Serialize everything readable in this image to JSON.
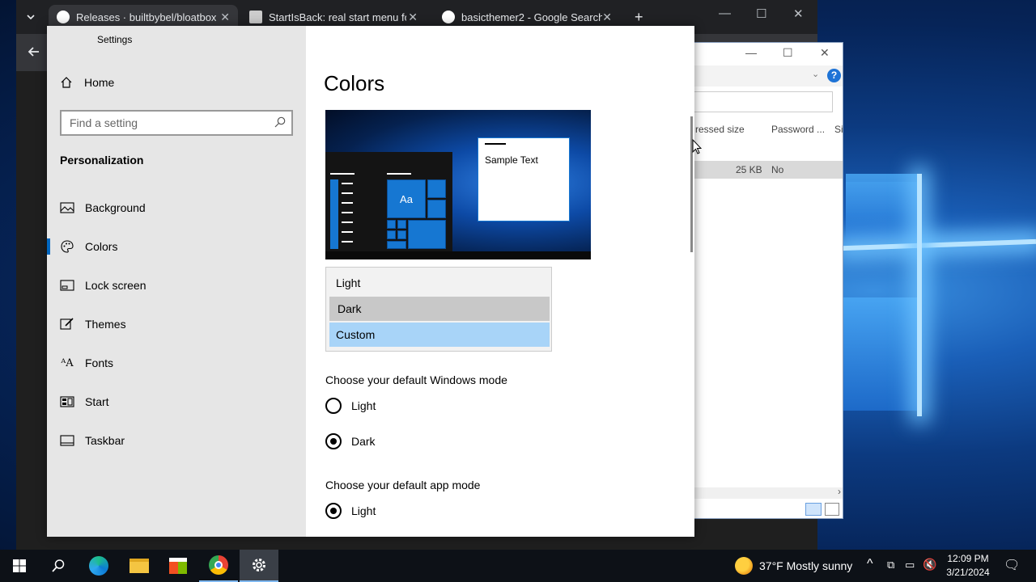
{
  "browser": {
    "tabs": [
      {
        "title": "Releases · builtbybel/bloatbox",
        "favicon": "github-icon"
      },
      {
        "title": "StartIsBack: real start menu for W",
        "favicon": "document-icon"
      },
      {
        "title": "basicthemer2 - Google Search",
        "favicon": "google-icon"
      }
    ]
  },
  "explorer": {
    "columns": [
      "ressed size",
      "Password ...",
      "Si"
    ],
    "row": {
      "size": "25 KB",
      "password": "No"
    }
  },
  "settings": {
    "app_title": "Settings",
    "home_label": "Home",
    "search_placeholder": "Find a setting",
    "section": "Personalization",
    "nav_items": [
      {
        "label": "Background",
        "icon": "picture-icon"
      },
      {
        "label": "Colors",
        "icon": "palette-icon"
      },
      {
        "label": "Lock screen",
        "icon": "lock-screen-icon"
      },
      {
        "label": "Themes",
        "icon": "brush-icon"
      },
      {
        "label": "Fonts",
        "icon": "font-icon"
      },
      {
        "label": "Start",
        "icon": "start-grid-icon"
      },
      {
        "label": "Taskbar",
        "icon": "taskbar-icon"
      }
    ],
    "selected_nav": "Colors",
    "page_title": "Colors",
    "preview": {
      "sample_text": "Sample Text",
      "tile_label": "Aa"
    },
    "color_options": [
      "Light",
      "Dark",
      "Custom"
    ],
    "hovered_option": "Dark",
    "selected_option": "Custom",
    "windows_mode": {
      "label": "Choose your default Windows mode",
      "options": [
        "Light",
        "Dark"
      ],
      "selected": "Dark"
    },
    "app_mode": {
      "label": "Choose your default app mode",
      "options": [
        "Light"
      ],
      "selected": "Light"
    },
    "accent_color": "#0067c0"
  },
  "taskbar": {
    "weather": "37°F  Mostly sunny",
    "time": "12:09 PM",
    "date": "3/21/2024"
  }
}
